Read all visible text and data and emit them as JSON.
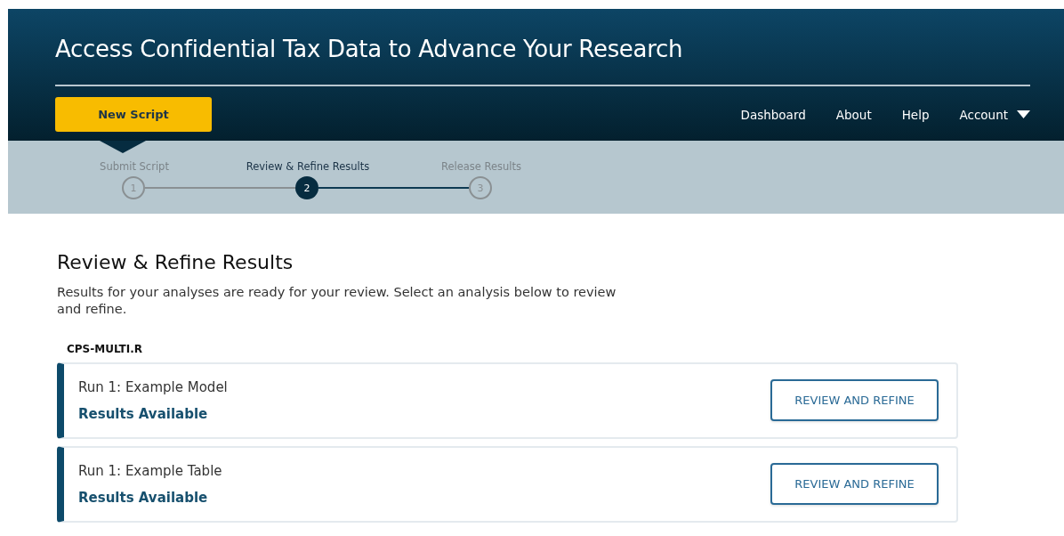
{
  "header": {
    "title": "Access Confidential Tax Data to Advance Your Research",
    "action_button": "New Script",
    "nav": [
      {
        "label": "Dashboard",
        "kind": "link"
      },
      {
        "label": "About",
        "kind": "link"
      },
      {
        "label": "Help",
        "kind": "link"
      },
      {
        "label": "Account",
        "kind": "menu"
      }
    ]
  },
  "stepper": [
    {
      "label": "Submit Script",
      "number": "1",
      "selected": false
    },
    {
      "label": "Review & Refine Results",
      "number": "2",
      "selected": true
    },
    {
      "label": "Release Results",
      "number": "3",
      "selected": false
    }
  ],
  "page": {
    "heading": "Review & Refine Results",
    "description": "Results for your analyses are ready for your review. Select an analysis below to review and refine.",
    "file_name": "CPS-MULTI.R"
  },
  "runs": [
    {
      "name": "Run 1: Example Model",
      "status": "Results Available",
      "button": "REVIEW AND REFINE"
    },
    {
      "name": "Run 1: Example Table",
      "status": "Results Available",
      "button": "REVIEW AND REFINE"
    }
  ]
}
